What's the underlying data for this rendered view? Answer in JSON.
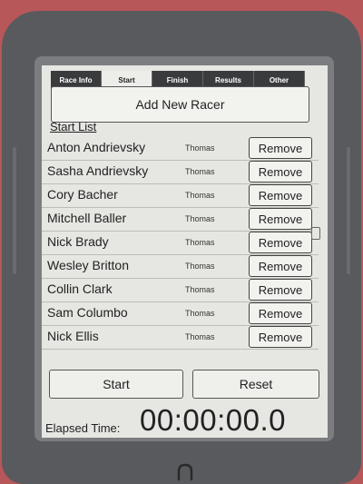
{
  "tabs": [
    "Race Info",
    "Start",
    "Finish",
    "Results",
    "Other"
  ],
  "active_tab": 1,
  "add_racer_label": "Add New Racer",
  "start_list_label": "Start List",
  "racers": [
    {
      "name": "Anton Andrievsky",
      "group": "Thomas",
      "action": "Remove"
    },
    {
      "name": "Sasha Andrievsky",
      "group": "Thomas",
      "action": "Remove"
    },
    {
      "name": "Cory Bacher",
      "group": "Thomas",
      "action": "Remove"
    },
    {
      "name": "Mitchell Baller",
      "group": "Thomas",
      "action": "Remove"
    },
    {
      "name": "Nick Brady",
      "group": "Thomas",
      "action": "Remove"
    },
    {
      "name": "Wesley Britton",
      "group": "Thomas",
      "action": "Remove"
    },
    {
      "name": "Collin Clark",
      "group": "Thomas",
      "action": "Remove"
    },
    {
      "name": "Sam Columbo",
      "group": "Thomas",
      "action": "Remove"
    },
    {
      "name": "Nick Ellis",
      "group": "Thomas",
      "action": "Remove"
    }
  ],
  "start_label": "Start",
  "reset_label": "Reset",
  "elapsed_label": "Elapsed Time:",
  "elapsed_value": "00:00:00.0",
  "icons": {
    "home": "nook-home-icon",
    "scroll": "scroll-handle-icon"
  },
  "colors": {
    "device_body": "#595a5d",
    "screen": "#e6e6e2",
    "tab_inactive": "#3a3b3d",
    "background": "#b8575a"
  }
}
